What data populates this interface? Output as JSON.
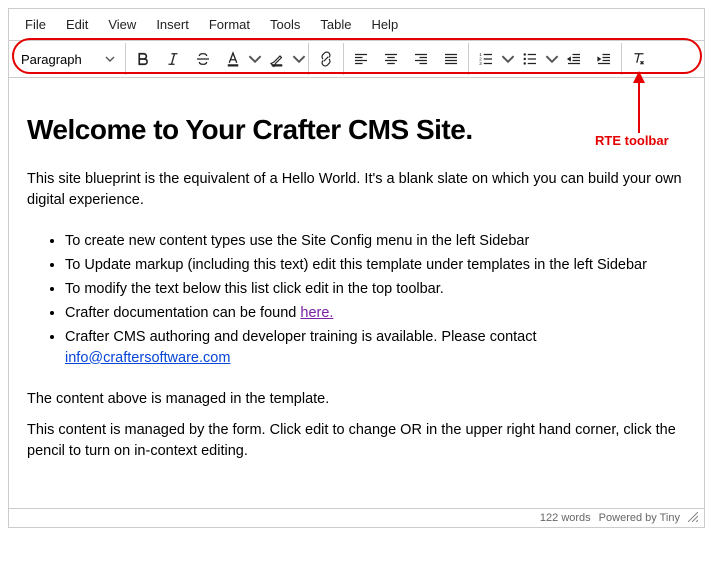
{
  "menubar": [
    "File",
    "Edit",
    "View",
    "Insert",
    "Format",
    "Tools",
    "Table",
    "Help"
  ],
  "format_select": "Paragraph",
  "annotation_label": "RTE toolbar",
  "content": {
    "heading": "Welcome to Your Crafter CMS Site.",
    "intro": "This site blueprint is the equivalent of a Hello World. It's a blank slate on which you can build your own digital experience.",
    "bullets": [
      "To create new content types use the Site Config menu in the left Sidebar",
      "To Update markup (including this text) edit this template under templates in the left Sidebar",
      "To modify the text below this list click edit in the top toolbar.",
      "Crafter documentation can be found ",
      "Crafter CMS authoring and developer training is available. Please contact "
    ],
    "link_here": "here.",
    "link_email": "info@craftersoftware.com",
    "p2": "The content above is managed in the template.",
    "p3": "This content is managed by the form.  Click edit to change OR in the upper right hand corner, click the pencil to turn on in-context editing."
  },
  "status": {
    "words": "122 words",
    "powered": "Powered by Tiny"
  }
}
